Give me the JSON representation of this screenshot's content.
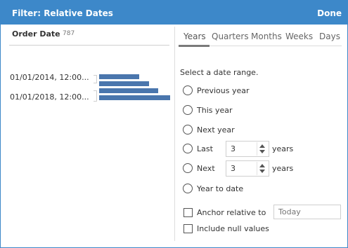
{
  "header": {
    "title": "Filter: Relative Dates",
    "done_label": "Done"
  },
  "field": {
    "name": "Order Date",
    "count": "787"
  },
  "histogram": {
    "labels": [
      "01/01/2014, 12:00...",
      "01/01/2018, 12:00..."
    ],
    "bar_color": "#4a76ad"
  },
  "tabs": [
    "Years",
    "Quarters",
    "Months",
    "Weeks",
    "Days"
  ],
  "active_tab": "Years",
  "prompt": "Select a date range.",
  "options": {
    "previous": "Previous year",
    "this": "This year",
    "next_year": "Next year",
    "last": "Last",
    "next": "Next",
    "to_date": "Year to date"
  },
  "last_value": "3",
  "next_value": "3",
  "unit": "years",
  "anchor": {
    "label": "Anchor relative to",
    "placeholder": "Today"
  },
  "include_null": "Include null values",
  "colors": {
    "accent": "#3d88c9"
  }
}
